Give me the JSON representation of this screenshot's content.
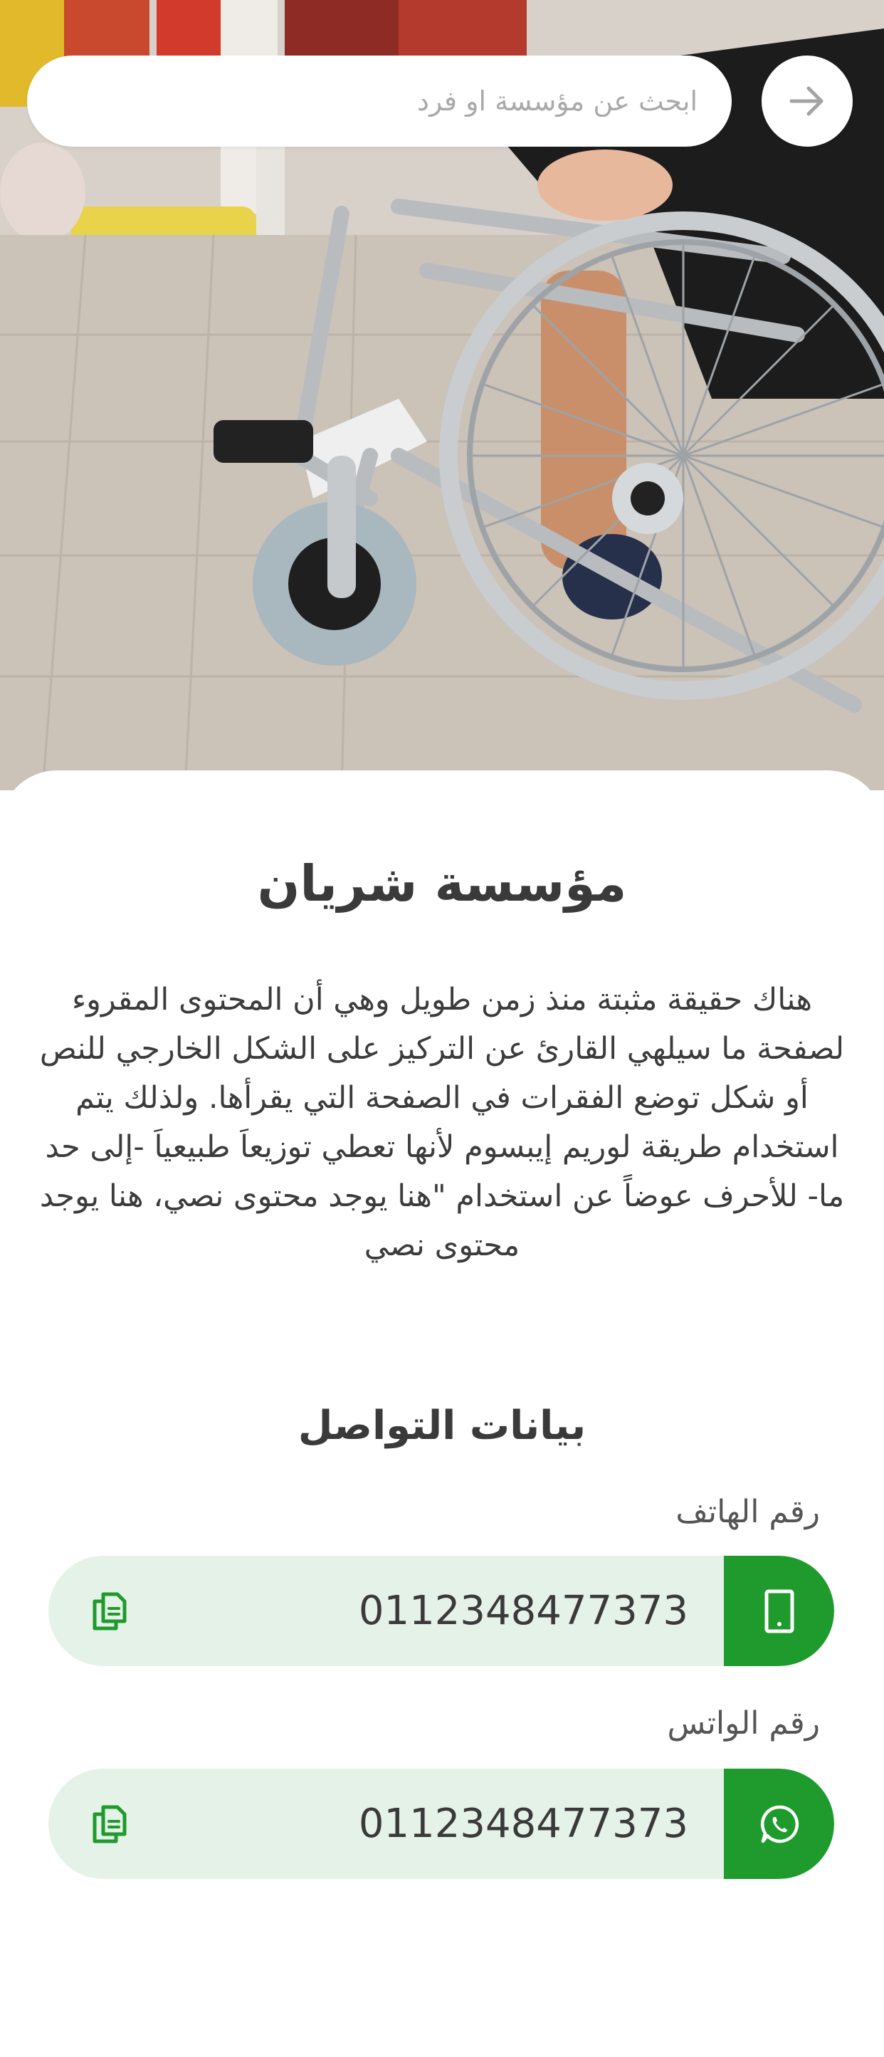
{
  "search": {
    "placeholder": "ابحث عن مؤسسة او فرد"
  },
  "icons": {
    "back": "arrow-right-icon",
    "phone": "smartphone-icon",
    "whatsapp": "whatsapp-icon",
    "copy": "copy-icon"
  },
  "colors": {
    "accent": "#1e9b2c",
    "row_background": "#e5f2e8",
    "text": "#3a3a3a"
  },
  "organization": {
    "name": "مؤسسة شريان",
    "description": "هناك حقيقة مثبتة منذ زمن طويل وهي أن المحتوى المقروء لصفحة ما سيلهي القارئ عن التركيز على الشكل الخارجي للنص أو شكل توضع الفقرات في الصفحة التي يقرأها. ولذلك يتم استخدام طريقة لوريم إيبسوم لأنها تعطي توزيعاَ طبيعياَ -إلى حد ما- للأحرف عوضاً عن استخدام \"هنا يوجد محتوى نصي، هنا يوجد محتوى نصي"
  },
  "contact": {
    "section_title": "بيانات التواصل",
    "phone": {
      "label": "رقم الهاتف",
      "value": "0112348477373"
    },
    "whatsapp": {
      "label": "رقم الواتس",
      "value": "0112348477373"
    }
  }
}
